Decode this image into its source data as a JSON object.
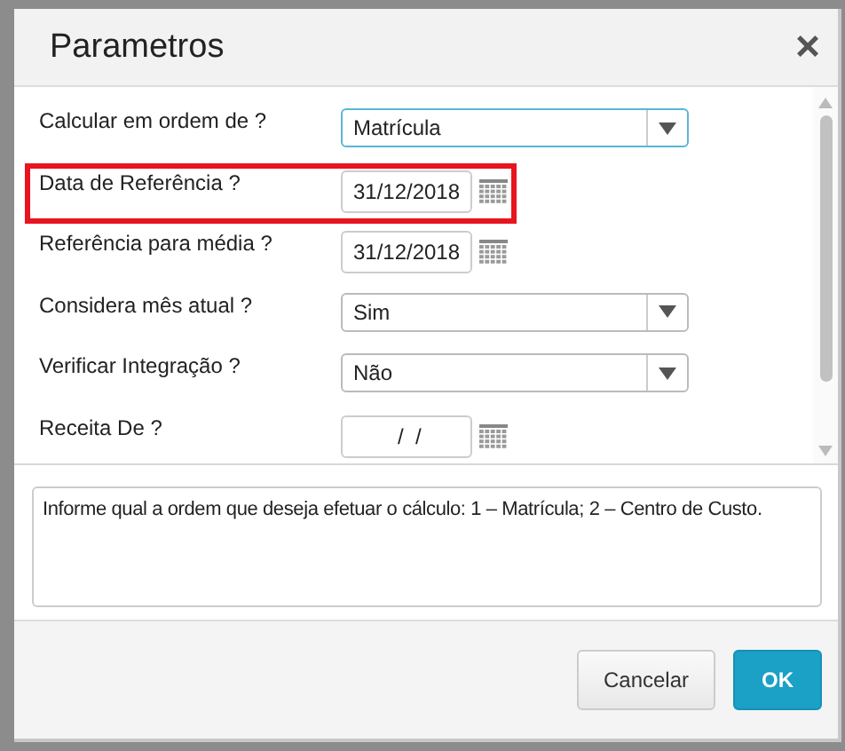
{
  "dialog": {
    "title": "Parametros",
    "close": "×"
  },
  "fields": [
    {
      "label": "Calcular em ordem de ?",
      "kind": "select",
      "value": "Matrícula",
      "focused": true,
      "highlighted": false
    },
    {
      "label": "Data de Referência ?",
      "kind": "date",
      "value": "31/12/2018",
      "focused": false,
      "highlighted": true
    },
    {
      "label": "Referência para média ?",
      "kind": "date",
      "value": "31/12/2018",
      "focused": false,
      "highlighted": false
    },
    {
      "label": "Considera mês atual ?",
      "kind": "select",
      "value": "Sim",
      "focused": false,
      "highlighted": false
    },
    {
      "label": "Verificar Integração ?",
      "kind": "select",
      "value": "Não",
      "focused": false,
      "highlighted": false
    },
    {
      "label": "Receita De ?",
      "kind": "date",
      "value": " /  /",
      "focused": false,
      "highlighted": false
    }
  ],
  "help": "Informe qual a ordem que deseja efetuar o cálculo: 1 – Matrícula; 2 – Centro de Custo.",
  "buttons": [
    {
      "label": "Cancelar",
      "kind": "secondary"
    },
    {
      "label": "OK",
      "kind": "primary"
    }
  ]
}
